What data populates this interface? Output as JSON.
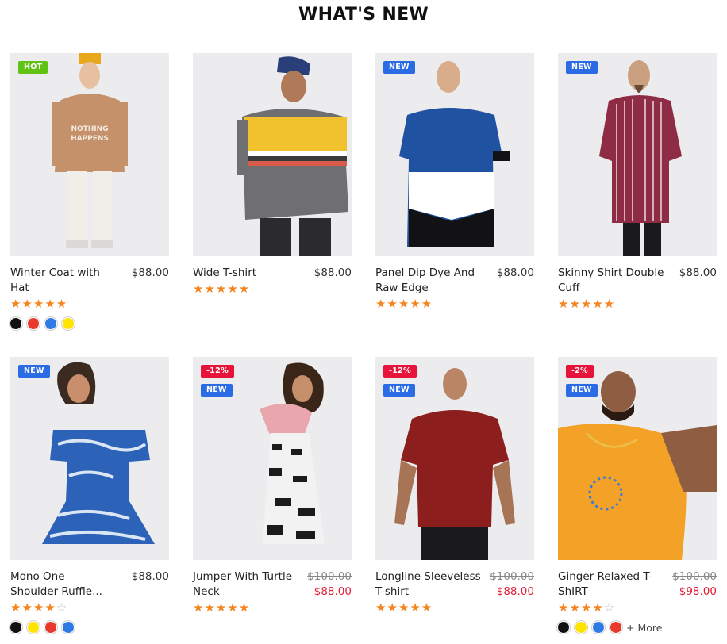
{
  "section": {
    "title": "WHAT'S NEW"
  },
  "products": [
    {
      "name": "Winter Coat with Hat",
      "price": "$88.00",
      "badges": [
        {
          "text": "HOT",
          "kind": "hot"
        }
      ],
      "rating": 5,
      "swatches": [
        "#111111",
        "#e8392c",
        "#2f7ae5",
        "#ffe400"
      ]
    },
    {
      "name": "Wide T-shirt",
      "price": "$88.00",
      "badges": [],
      "rating": 5,
      "swatches": []
    },
    {
      "name": "Panel Dip Dye And Raw Edge",
      "price": "$88.00",
      "badges": [
        {
          "text": "NEW",
          "kind": "new"
        }
      ],
      "rating": 5,
      "swatches": []
    },
    {
      "name": "Skinny Shirt Double Cuff",
      "price": "$88.00",
      "badges": [
        {
          "text": "NEW",
          "kind": "new"
        }
      ],
      "rating": 5,
      "swatches": []
    },
    {
      "name": "Mono One Shoulder Ruffle...",
      "price": "$88.00",
      "badges": [
        {
          "text": "NEW",
          "kind": "new"
        }
      ],
      "rating": 4,
      "swatches": [
        "#111111",
        "#ffe400",
        "#e8392c",
        "#2f7ae5"
      ]
    },
    {
      "name": "Jumper With Turtle Neck",
      "old_price": "$100.00",
      "sale_price": "$88.00",
      "badges": [
        {
          "text": "-12%",
          "kind": "sale"
        },
        {
          "text": "NEW",
          "kind": "new"
        }
      ],
      "rating": 5,
      "swatches": []
    },
    {
      "name": "Longline Sleeveless T-shirt",
      "old_price": "$100.00",
      "sale_price": "$88.00",
      "badges": [
        {
          "text": "-12%",
          "kind": "sale"
        },
        {
          "text": "NEW",
          "kind": "new"
        }
      ],
      "rating": 5,
      "swatches": []
    },
    {
      "name": "Ginger Relaxed T-ShIRT",
      "old_price": "$100.00",
      "sale_price": "$98.00",
      "badges": [
        {
          "text": "-2%",
          "kind": "sale"
        },
        {
          "text": "NEW",
          "kind": "new"
        }
      ],
      "rating": 4,
      "swatches": [
        "#111111",
        "#ffe400",
        "#2f7ae5",
        "#e8392c"
      ],
      "more_label": "+ More"
    }
  ],
  "colors": {
    "star": "#f5841f",
    "sale": "#e0203a",
    "badge_new": "#2b6be6",
    "badge_hot": "#5fc214",
    "badge_sale": "#e8133a"
  }
}
